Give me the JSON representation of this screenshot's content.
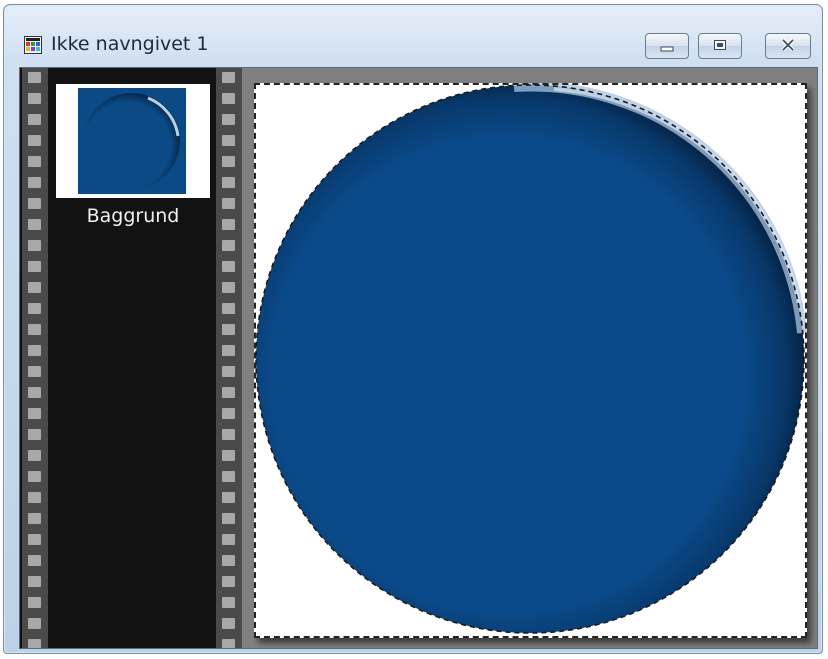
{
  "window": {
    "title": "Ikke navngivet 1",
    "controls": {
      "minimize": "minimize-icon",
      "maximize": "restore-icon",
      "close": "close-icon"
    }
  },
  "layers": [
    {
      "name": "Baggrund"
    }
  ],
  "canvas": {
    "shape": "circle",
    "fill_color": "#0a4a8a",
    "background_color": "#ffffff",
    "selection": "circle-marquee"
  }
}
